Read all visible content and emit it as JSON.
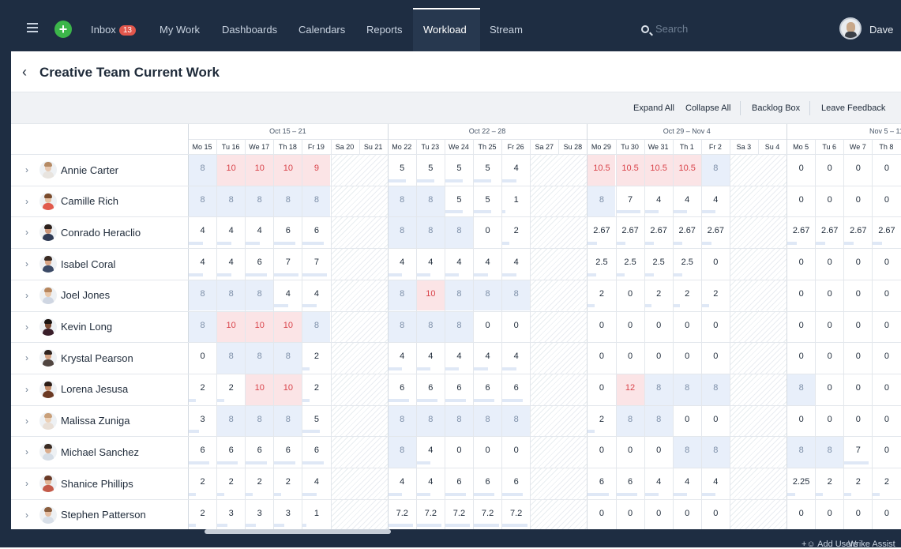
{
  "nav": {
    "inbox_label": "Inbox",
    "inbox_count": "13",
    "items": [
      "My Work",
      "Dashboards",
      "Calendars",
      "Reports",
      "Workload",
      "Stream"
    ],
    "active": "Workload",
    "search_placeholder": "Search",
    "user_name": "Dave"
  },
  "page": {
    "title": "Creative Team Current Work"
  },
  "toolbar": {
    "expand_all": "Expand All",
    "collapse_all": "Collapse All",
    "backlog_box": "Backlog Box",
    "leave_feedback": "Leave Feedback"
  },
  "weeks": [
    "Oct 15 – 21",
    "Oct 22 – 28",
    "Oct 29 – Nov 4",
    "Nov 5 – 11"
  ],
  "days": [
    "Mo 15",
    "Tu 16",
    "We 17",
    "Th 18",
    "Fr 19",
    "Sa 20",
    "Su 21",
    "Mo 22",
    "Tu 23",
    "We 24",
    "Th 25",
    "Fr 26",
    "Sa 27",
    "Su 28",
    "Mo 29",
    "Tu 30",
    "We 31",
    "Th 1",
    "Fr 2",
    "Sa 3",
    "Su 4",
    "Mo 5",
    "Tu 6",
    "We 7",
    "Th 8"
  ],
  "people": [
    {
      "name": "Annie Carter",
      "values": [
        "8",
        "10",
        "10",
        "10",
        "9",
        "",
        "",
        "5",
        "5",
        "5",
        "5",
        "4",
        "",
        "",
        "10.5",
        "10.5",
        "10.5",
        "10.5",
        "8",
        "",
        "",
        "0",
        "0",
        "0",
        "0"
      ],
      "states": [
        "f",
        "o",
        "o",
        "o",
        "o",
        "",
        "",
        "n",
        "n",
        "n",
        "n",
        "n",
        "",
        "",
        "o",
        "o",
        "o",
        "o",
        "f",
        "",
        "",
        "n",
        "n",
        "n",
        "n"
      ]
    },
    {
      "name": "Camille Rich",
      "values": [
        "8",
        "8",
        "8",
        "8",
        "8",
        "",
        "",
        "8",
        "8",
        "5",
        "5",
        "1",
        "",
        "",
        "8",
        "7",
        "4",
        "4",
        "4",
        "",
        "",
        "0",
        "0",
        "0",
        "0"
      ],
      "states": [
        "f",
        "f",
        "f",
        "f",
        "f",
        "",
        "",
        "f",
        "f",
        "n",
        "n",
        "n",
        "",
        "",
        "f",
        "n",
        "n",
        "n",
        "n",
        "",
        "",
        "n",
        "n",
        "n",
        "n"
      ]
    },
    {
      "name": "Conrado Heraclio",
      "values": [
        "4",
        "4",
        "4",
        "6",
        "6",
        "",
        "",
        "8",
        "8",
        "8",
        "0",
        "2",
        "",
        "",
        "2.67",
        "2.67",
        "2.67",
        "2.67",
        "2.67",
        "",
        "",
        "2.67",
        "2.67",
        "2.67",
        "2.67"
      ],
      "states": [
        "n",
        "n",
        "n",
        "n",
        "n",
        "",
        "",
        "f",
        "f",
        "f",
        "n",
        "n",
        "",
        "",
        "n",
        "n",
        "n",
        "n",
        "n",
        "",
        "",
        "n",
        "n",
        "n",
        "n"
      ]
    },
    {
      "name": "Isabel Coral",
      "values": [
        "4",
        "4",
        "6",
        "7",
        "7",
        "",
        "",
        "4",
        "4",
        "4",
        "4",
        "4",
        "",
        "",
        "2.5",
        "2.5",
        "2.5",
        "2.5",
        "0",
        "",
        "",
        "0",
        "0",
        "0",
        "0"
      ],
      "states": [
        "n",
        "n",
        "n",
        "n",
        "n",
        "",
        "",
        "n",
        "n",
        "n",
        "n",
        "n",
        "",
        "",
        "n",
        "n",
        "n",
        "n",
        "n",
        "",
        "",
        "n",
        "n",
        "n",
        "n"
      ]
    },
    {
      "name": "Joel Jones",
      "values": [
        "8",
        "8",
        "8",
        "4",
        "4",
        "",
        "",
        "8",
        "10",
        "8",
        "8",
        "8",
        "",
        "",
        "2",
        "0",
        "2",
        "2",
        "2",
        "",
        "",
        "0",
        "0",
        "0",
        "0"
      ],
      "states": [
        "f",
        "f",
        "f",
        "n",
        "n",
        "",
        "",
        "f",
        "o",
        "f",
        "f",
        "f",
        "",
        "",
        "n",
        "n",
        "n",
        "n",
        "n",
        "",
        "",
        "n",
        "n",
        "n",
        "n"
      ]
    },
    {
      "name": "Kevin Long",
      "values": [
        "8",
        "10",
        "10",
        "10",
        "8",
        "",
        "",
        "8",
        "8",
        "8",
        "0",
        "0",
        "",
        "",
        "0",
        "0",
        "0",
        "0",
        "0",
        "",
        "",
        "0",
        "0",
        "0",
        "0"
      ],
      "states": [
        "f",
        "o",
        "o",
        "o",
        "f",
        "",
        "",
        "f",
        "f",
        "f",
        "n",
        "n",
        "",
        "",
        "n",
        "n",
        "n",
        "n",
        "n",
        "",
        "",
        "n",
        "n",
        "n",
        "n"
      ]
    },
    {
      "name": "Krystal Pearson",
      "values": [
        "0",
        "8",
        "8",
        "8",
        "2",
        "",
        "",
        "4",
        "4",
        "4",
        "4",
        "4",
        "",
        "",
        "0",
        "0",
        "0",
        "0",
        "0",
        "",
        "",
        "0",
        "0",
        "0",
        "0"
      ],
      "states": [
        "n",
        "f",
        "f",
        "f",
        "n",
        "",
        "",
        "n",
        "n",
        "n",
        "n",
        "n",
        "",
        "",
        "n",
        "n",
        "n",
        "n",
        "n",
        "",
        "",
        "n",
        "n",
        "n",
        "n"
      ]
    },
    {
      "name": "Lorena Jesusa",
      "values": [
        "2",
        "2",
        "10",
        "10",
        "2",
        "",
        "",
        "6",
        "6",
        "6",
        "6",
        "6",
        "",
        "",
        "0",
        "12",
        "8",
        "8",
        "8",
        "",
        "",
        "8",
        "0",
        "0",
        "0"
      ],
      "states": [
        "n",
        "n",
        "o",
        "o",
        "n",
        "",
        "",
        "n",
        "n",
        "n",
        "n",
        "n",
        "",
        "",
        "n",
        "o",
        "f",
        "f",
        "f",
        "",
        "",
        "f",
        "n",
        "n",
        "n"
      ]
    },
    {
      "name": "Malissa Zuniga",
      "values": [
        "3",
        "8",
        "8",
        "8",
        "5",
        "",
        "",
        "8",
        "8",
        "8",
        "8",
        "8",
        "",
        "",
        "2",
        "8",
        "8",
        "0",
        "0",
        "",
        "",
        "0",
        "0",
        "0",
        "0"
      ],
      "states": [
        "n",
        "f",
        "f",
        "f",
        "n",
        "",
        "",
        "f",
        "f",
        "f",
        "f",
        "f",
        "",
        "",
        "n",
        "f",
        "f",
        "n",
        "n",
        "",
        "",
        "n",
        "n",
        "n",
        "n"
      ]
    },
    {
      "name": "Michael Sanchez",
      "values": [
        "6",
        "6",
        "6",
        "6",
        "6",
        "",
        "",
        "8",
        "4",
        "0",
        "0",
        "0",
        "",
        "",
        "0",
        "0",
        "0",
        "8",
        "8",
        "",
        "",
        "8",
        "8",
        "7",
        "0"
      ],
      "states": [
        "n",
        "n",
        "n",
        "n",
        "n",
        "",
        "",
        "f",
        "n",
        "n",
        "n",
        "n",
        "",
        "",
        "n",
        "n",
        "n",
        "f",
        "f",
        "",
        "",
        "f",
        "f",
        "n",
        "n"
      ]
    },
    {
      "name": "Shanice Phillips",
      "values": [
        "2",
        "2",
        "2",
        "2",
        "4",
        "",
        "",
        "4",
        "4",
        "6",
        "6",
        "6",
        "",
        "",
        "6",
        "6",
        "4",
        "4",
        "4",
        "",
        "",
        "2.25",
        "2",
        "2",
        "2"
      ],
      "states": [
        "n",
        "n",
        "n",
        "n",
        "n",
        "",
        "",
        "n",
        "n",
        "n",
        "n",
        "n",
        "",
        "",
        "n",
        "n",
        "n",
        "n",
        "n",
        "",
        "",
        "n",
        "n",
        "n",
        "n"
      ]
    },
    {
      "name": "Stephen Patterson",
      "values": [
        "2",
        "3",
        "3",
        "3",
        "1",
        "",
        "",
        "7.2",
        "7.2",
        "7.2",
        "7.2",
        "7.2",
        "",
        "",
        "0",
        "0",
        "0",
        "0",
        "0",
        "",
        "",
        "0",
        "0",
        "0",
        "0"
      ],
      "states": [
        "n",
        "n",
        "n",
        "n",
        "n",
        "",
        "",
        "n",
        "n",
        "n",
        "n",
        "n",
        "",
        "",
        "n",
        "n",
        "n",
        "n",
        "n",
        "",
        "",
        "n",
        "n",
        "n",
        "n"
      ]
    }
  ],
  "footer": {
    "add_users": "Add Users",
    "assistant": "Wrike Assist"
  },
  "colors": {
    "nav_bg": "#1e2d42",
    "full_cell": "#e8effa",
    "over_cell": "#fbe4e6",
    "over_text": "#d9434a",
    "add_button": "#3cb64a"
  }
}
